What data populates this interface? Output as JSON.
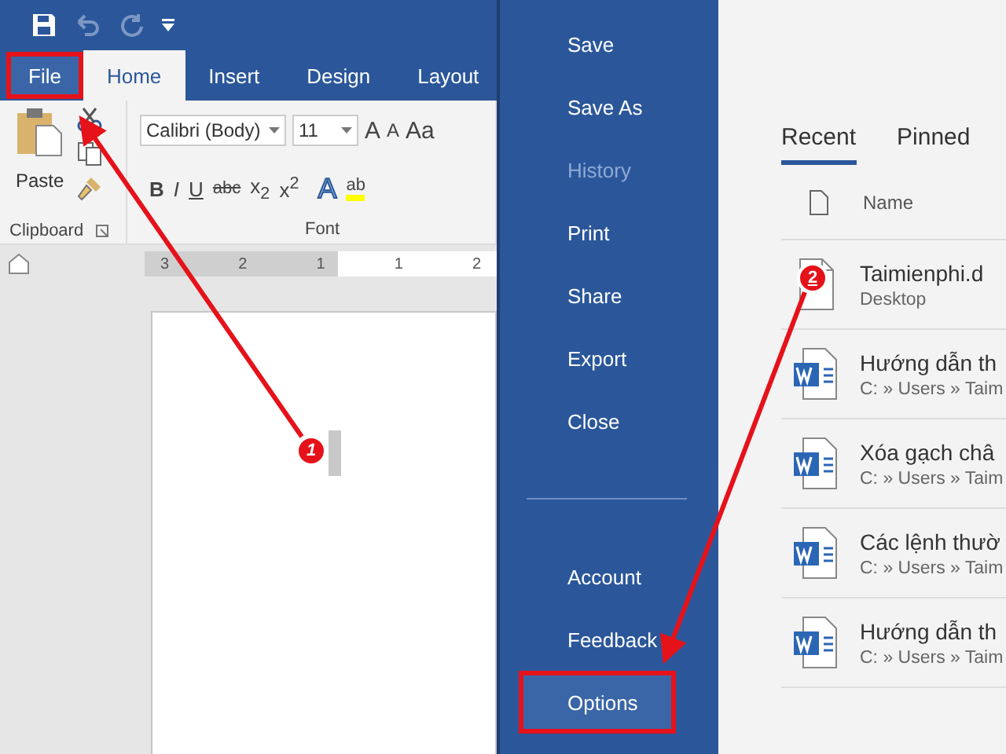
{
  "tabs": [
    {
      "label": "File",
      "selected": false,
      "highlighted": true
    },
    {
      "label": "Home",
      "selected": true,
      "highlighted": false
    },
    {
      "label": "Insert",
      "selected": false,
      "highlighted": false
    },
    {
      "label": "Design",
      "selected": false,
      "highlighted": false
    },
    {
      "label": "Layout",
      "selected": false,
      "highlighted": false
    }
  ],
  "clipboard": {
    "paste_label": "Paste",
    "group_label": "Clipboard"
  },
  "font": {
    "name": "Calibri (Body)",
    "size": "11",
    "grow_label": "A",
    "shrink_label": "A",
    "case_label": "Aa",
    "format_buttons": [
      "B",
      "I",
      "U",
      "abc",
      "x$_{2}$",
      "x$^{2}$"
    ],
    "effects_label": "A",
    "highlight_label": "ab",
    "group_label": "Font"
  },
  "ruler": {
    "labels": [
      "3",
      "2",
      "1",
      "1",
      "2"
    ]
  },
  "annotations": [
    {
      "number": "1"
    },
    {
      "number": "2"
    }
  ],
  "backstage": {
    "nav": [
      {
        "label": "Save",
        "disabled": false,
        "highlighted": false,
        "kind": "item"
      },
      {
        "label": "Save As",
        "disabled": false,
        "highlighted": false,
        "kind": "item"
      },
      {
        "label": "History",
        "disabled": true,
        "highlighted": false,
        "kind": "item"
      },
      {
        "label": "Print",
        "disabled": false,
        "highlighted": false,
        "kind": "item"
      },
      {
        "label": "Share",
        "disabled": false,
        "highlighted": false,
        "kind": "item"
      },
      {
        "label": "Export",
        "disabled": false,
        "highlighted": false,
        "kind": "item"
      },
      {
        "label": "Close",
        "disabled": false,
        "highlighted": false,
        "kind": "item"
      },
      {
        "kind": "divider"
      },
      {
        "label": "Account",
        "disabled": false,
        "highlighted": false,
        "kind": "item"
      },
      {
        "label": "Feedback",
        "disabled": false,
        "highlighted": false,
        "kind": "item"
      },
      {
        "label": "Options",
        "disabled": false,
        "highlighted": true,
        "kind": "item"
      }
    ],
    "tabs": [
      {
        "label": "Recent",
        "selected": true
      },
      {
        "label": "Pinned",
        "selected": false
      }
    ],
    "column": "Name",
    "files": [
      {
        "name": "Taimienphi.d",
        "location": "Desktop",
        "kind": "document"
      },
      {
        "name": "Hướng dẫn th",
        "location": "C: » Users » Taim",
        "kind": "word"
      },
      {
        "name": "Xóa gạch châ",
        "location": "C: » Users » Taim",
        "kind": "word"
      },
      {
        "name": "Các lệnh thườ",
        "location": "C: » Users » Taim",
        "kind": "word"
      },
      {
        "name": "Hướng dẫn th",
        "location": "C: » Users » Taim",
        "kind": "word"
      }
    ]
  }
}
